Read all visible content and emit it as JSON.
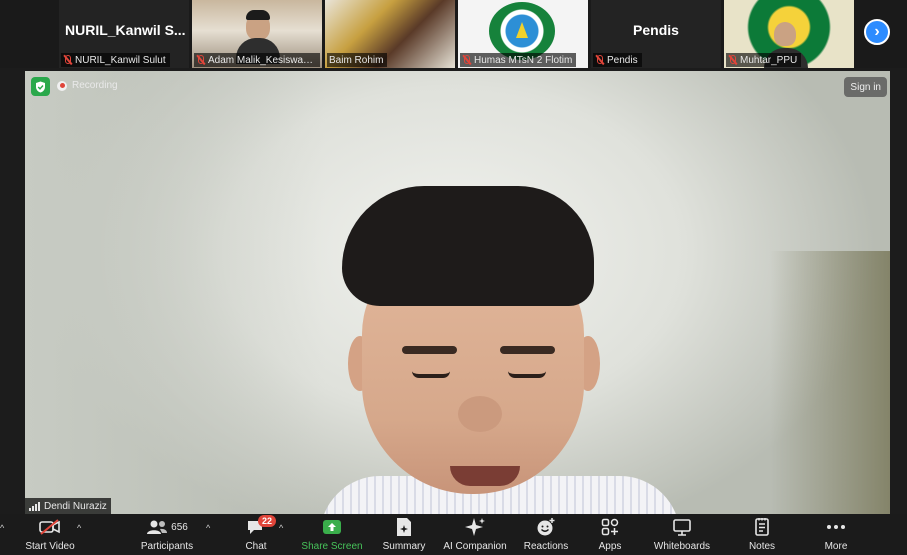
{
  "strip": {
    "participants": [
      {
        "name": "NURIL_Kanwil Sulut",
        "display": "NURIL_Kanwil  S...",
        "video": false
      },
      {
        "name": "Adam Malik_Kesiswaa...",
        "video": true
      },
      {
        "name": "Baim Rohim",
        "video": true
      },
      {
        "name": "Humas MTsN 2 Flotim",
        "video": true
      },
      {
        "name": "Pendis",
        "display": "Pendis",
        "video": false
      },
      {
        "name": "Muhtar_PPU",
        "video": true
      }
    ],
    "next_icon": "chevron-right-icon"
  },
  "main": {
    "recording_label": "Recording",
    "sign_in_label": "Sign in",
    "speaker_name": "Dendi Nuraziz",
    "accent_green": "#2aa84b",
    "recording_red": "#e0453a"
  },
  "toolbar": {
    "start_video": "Start Video",
    "participants": "Participants",
    "participants_count": "656",
    "chat": "Chat",
    "chat_badge": "22",
    "share_screen": "Share Screen",
    "summary": "Summary",
    "ai_companion": "AI Companion",
    "reactions": "Reactions",
    "apps": "Apps",
    "whiteboards": "Whiteboards",
    "notes": "Notes",
    "more": "More",
    "share_color": "#47c35a"
  }
}
